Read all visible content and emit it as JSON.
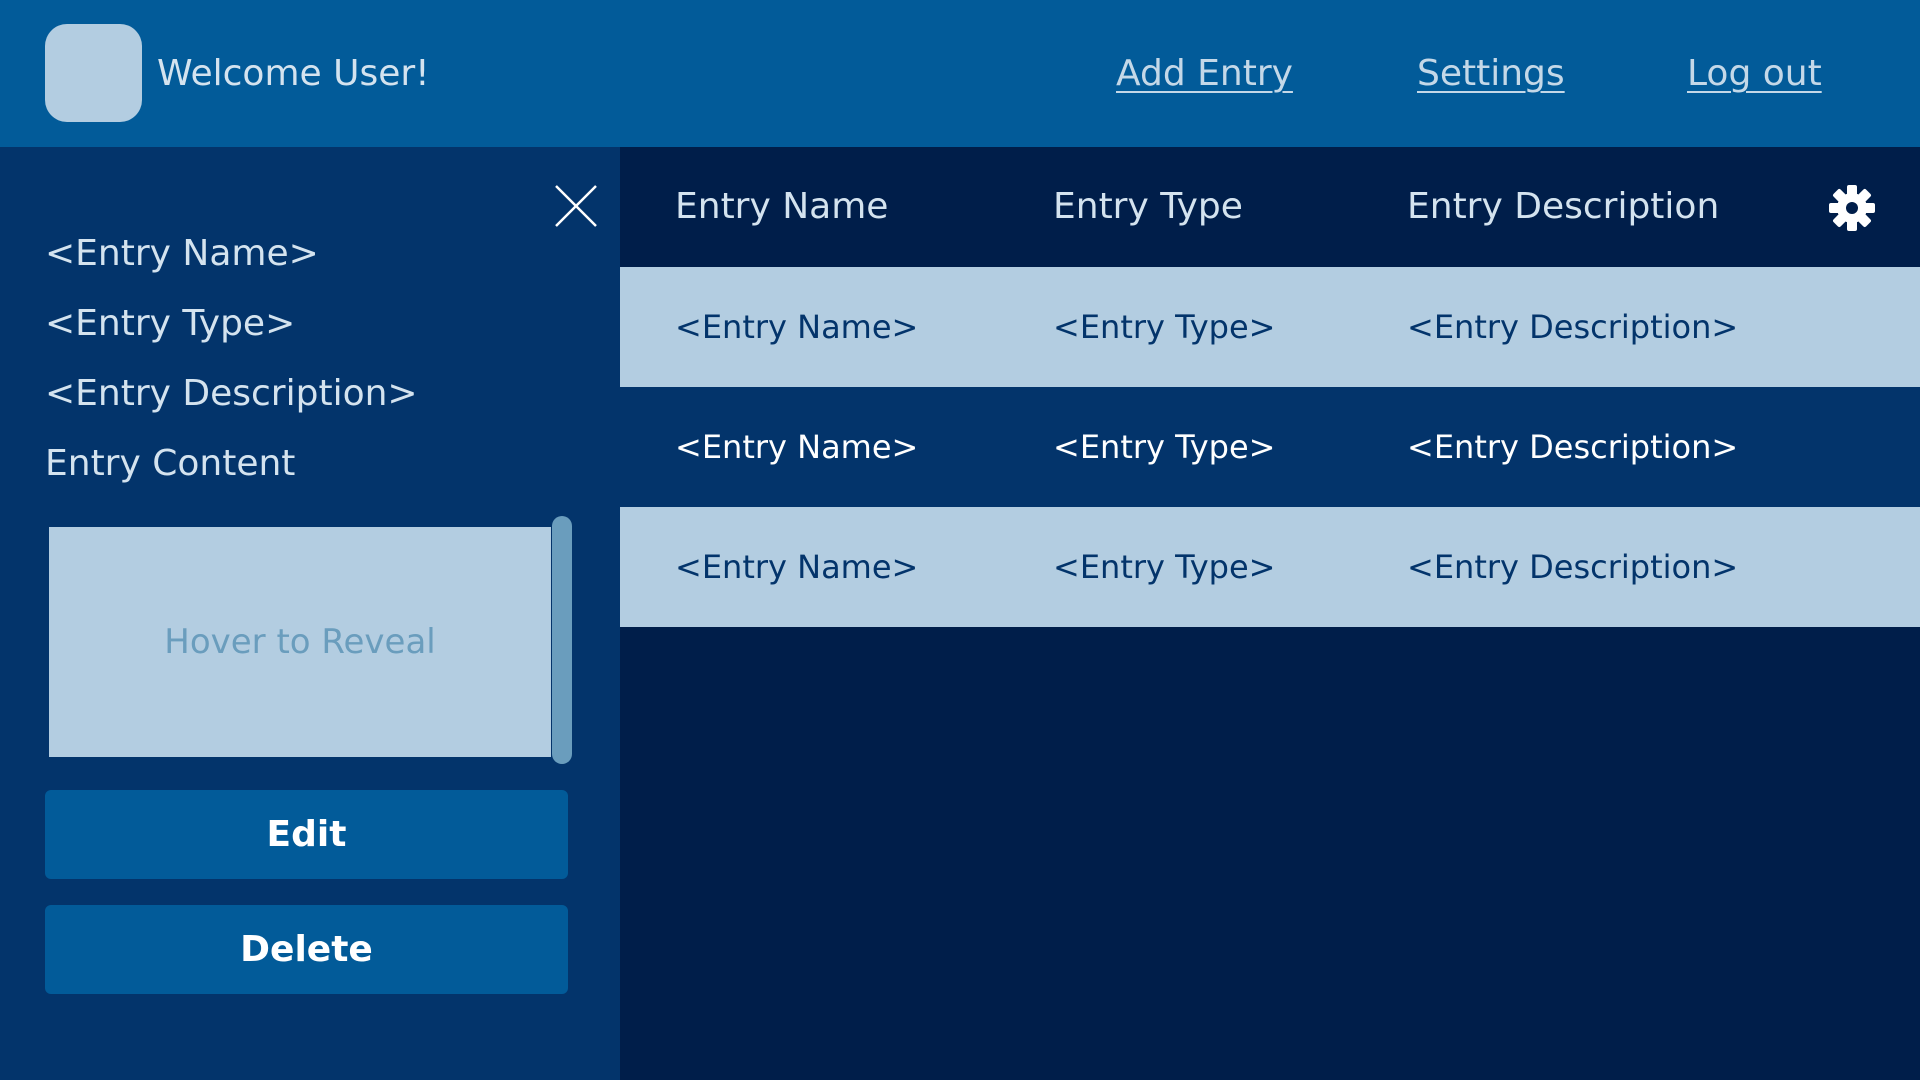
{
  "header": {
    "welcome": "Welcome User!",
    "nav": {
      "add_entry": "Add Entry",
      "settings": "Settings",
      "log_out": "Log out"
    }
  },
  "sidebar": {
    "entry_name": "<Entry Name>",
    "entry_type": "<Entry Type>",
    "entry_description": "<Entry Description>",
    "content_label": "Entry Content",
    "content_hint": "Hover to Reveal",
    "edit_label": "Edit",
    "delete_label": "Delete",
    "close_icon": "close-icon"
  },
  "table": {
    "headers": {
      "name": "Entry Name",
      "type": "Entry Type",
      "description": "Entry Description"
    },
    "settings_icon": "gear-icon",
    "rows": [
      {
        "name": "<Entry Name>",
        "type": "<Entry Type>",
        "description": "<Entry Description>"
      },
      {
        "name": "<Entry Name>",
        "type": "<Entry Type>",
        "description": "<Entry Description>"
      },
      {
        "name": "<Entry Name>",
        "type": "<Entry Type>",
        "description": "<Entry Description>"
      }
    ]
  },
  "colors": {
    "header_bg": "#025b99",
    "sidebar_bg": "#03346b",
    "main_bg": "#001e4a",
    "row_light": "#b3cde1",
    "button_bg": "#025b99"
  }
}
